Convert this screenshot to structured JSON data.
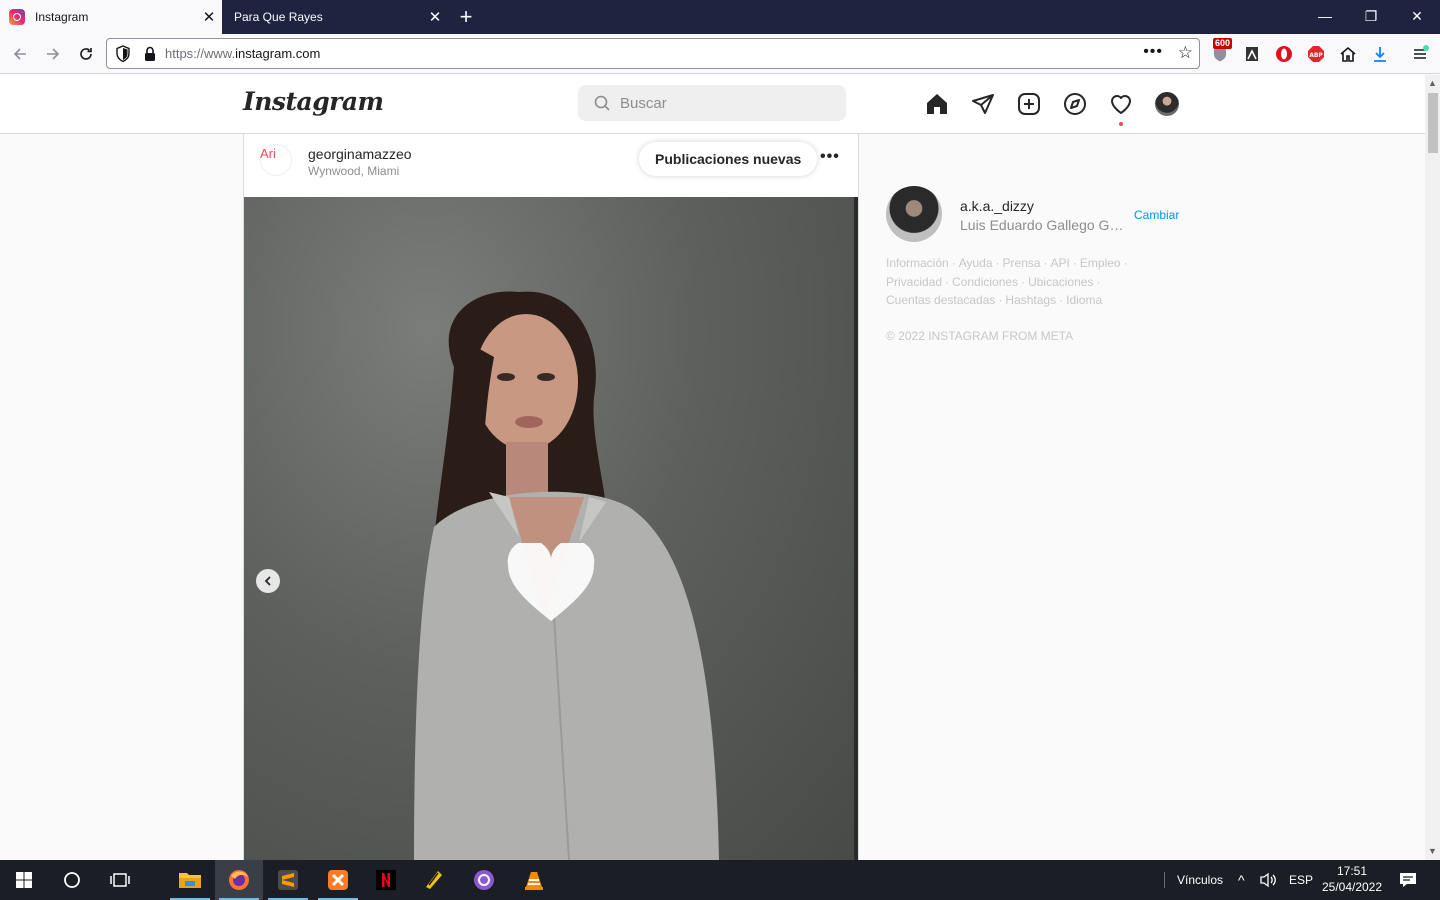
{
  "browser": {
    "tabs": [
      {
        "title": "Instagram",
        "active": true
      },
      {
        "title": "Para Que Rayes",
        "active": false
      }
    ],
    "url_prefix": "https://www.",
    "url_domain": "instagram.com",
    "extension_badge": "600"
  },
  "instagram": {
    "logo": "Instagram",
    "search": {
      "placeholder": "Buscar"
    },
    "nav_icons": [
      "home-icon",
      "direct-icon",
      "new-post-icon",
      "explore-icon",
      "activity-icon",
      "profile-avatar"
    ],
    "post": {
      "avatar_alt": "Ari",
      "username": "georginamazzeo",
      "location": "Wynwood, Miami",
      "new_posts_label": "Publicaciones nuevas",
      "more_label": "•••"
    },
    "sidebar": {
      "username": "a.k.a._dizzy",
      "full_name": "Luis Eduardo Gallego García",
      "switch_label": "Cambiar",
      "footer_links": [
        "Información",
        "Ayuda",
        "Prensa",
        "API",
        "Empleo",
        "Privacidad",
        "Condiciones",
        "Ubicaciones",
        "Cuentas destacadas",
        "Hashtags",
        "Idioma"
      ],
      "copyright": "© 2022 INSTAGRAM FROM META"
    }
  },
  "taskbar": {
    "links_label": "Vínculos",
    "language": "ESP",
    "time": "17:51",
    "date": "25/04/2022"
  },
  "colors": {
    "tabstrip": "#202340",
    "link_blue": "#0095f6",
    "notification": "#ed4956",
    "taskbar": "#1b1e25"
  }
}
